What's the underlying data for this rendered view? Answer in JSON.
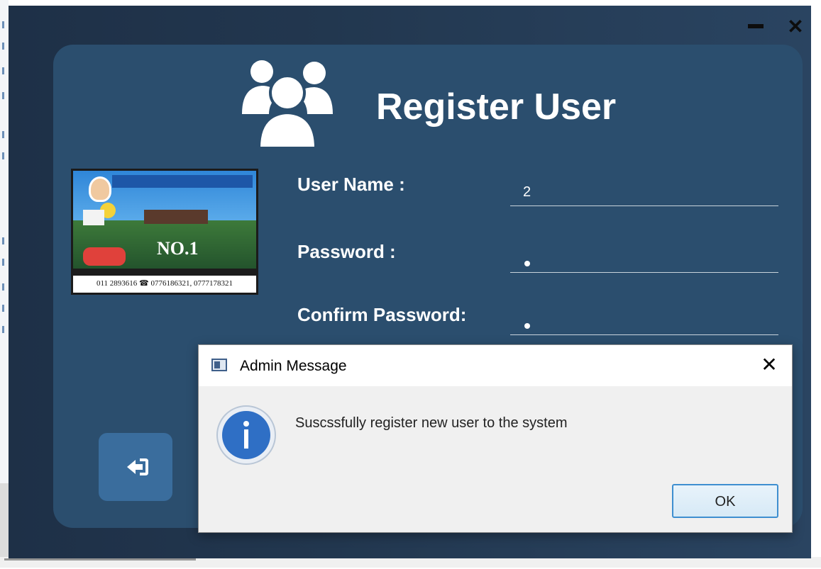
{
  "window": {
    "minimize_icon": "minimize-icon",
    "close_icon": "bold-close-icon"
  },
  "form": {
    "title": "Register User",
    "header_icon": "users-group-icon",
    "username_label": "User Name :",
    "username_value": "2",
    "password_label": "Password :",
    "password_value": "•",
    "confirm_label": "Confirm Password:",
    "confirm_value": "•",
    "back_icon": "sign-in-arrow-icon"
  },
  "ad": {
    "phone": "011 2893616 ☎ 0776186321, 0777178321",
    "badge": "NO.1"
  },
  "dialog": {
    "title": "Admin Message",
    "message": "Suscssfully register new user to the system",
    "ok_label": "OK",
    "info_icon": "info-icon",
    "close_symbol": "✕"
  },
  "colors": {
    "window_bg": "#22374f",
    "card_bg": "#2b4e6e",
    "button_bg": "#3a6d9d",
    "ok_border": "#3e8fd0",
    "info_blue": "#2f6fc5"
  }
}
